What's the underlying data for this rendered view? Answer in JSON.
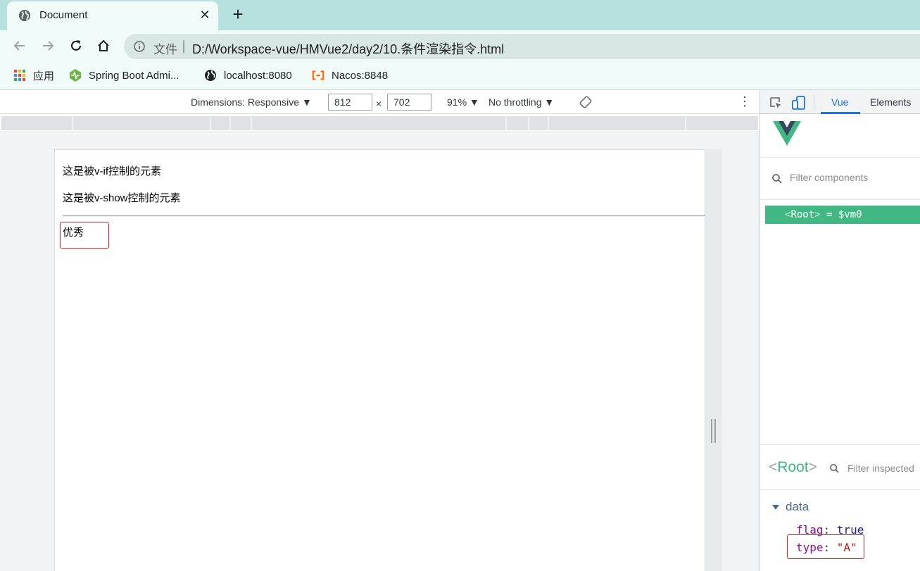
{
  "browser": {
    "tab": {
      "title": "Document",
      "close_glyph": "✕",
      "new_tab_glyph": "+"
    },
    "address": {
      "file_label": "文件",
      "separator": "|",
      "url": "D:/Workspace-vue/HMVue2/day2/10.条件渲染指令.html"
    },
    "bookmarks": [
      {
        "label": "应用",
        "icon": "apps-grid-icon"
      },
      {
        "label": "Spring Boot Admi...",
        "icon": "heartbeat-icon"
      },
      {
        "label": "localhost:8080",
        "icon": "globe-icon"
      },
      {
        "label": "Nacos:8848",
        "icon": "nacos-icon"
      }
    ]
  },
  "device_toolbar": {
    "dimensions_label": "Dimensions: Responsive ▼",
    "width": "812",
    "times": "×",
    "height": "702",
    "zoom": "91% ▼",
    "throttling": "No throttling ▼",
    "more_glyph": "⋮"
  },
  "page": {
    "v_if_text": "这是被v-if控制的元素",
    "v_show_text": "这是被v-show控制的元素",
    "grade_text": "优秀"
  },
  "devtools": {
    "tabs": [
      "Vue",
      "Elements"
    ],
    "active_tab": "Vue",
    "filter_components_placeholder": "Filter components",
    "root_component": {
      "open": "<",
      "name": "Root",
      "close": ">",
      "ref": " = $vm0"
    },
    "inspector": {
      "root_label_open": "<",
      "root_label_name": "Root",
      "root_label_close": ">",
      "filter_placeholder": "Filter inspected",
      "section": "data",
      "props": [
        {
          "key": "flag",
          "sep": ": ",
          "value": "true"
        },
        {
          "key": "type",
          "sep": ": ",
          "value": "\"A\""
        }
      ]
    }
  },
  "colors": {
    "tab_strip": "#b7e1dd",
    "vue_green": "#41b883",
    "vue_dark": "#35495e",
    "highlight_border": "#d22222",
    "devtools_blue": "#1a73e8"
  }
}
